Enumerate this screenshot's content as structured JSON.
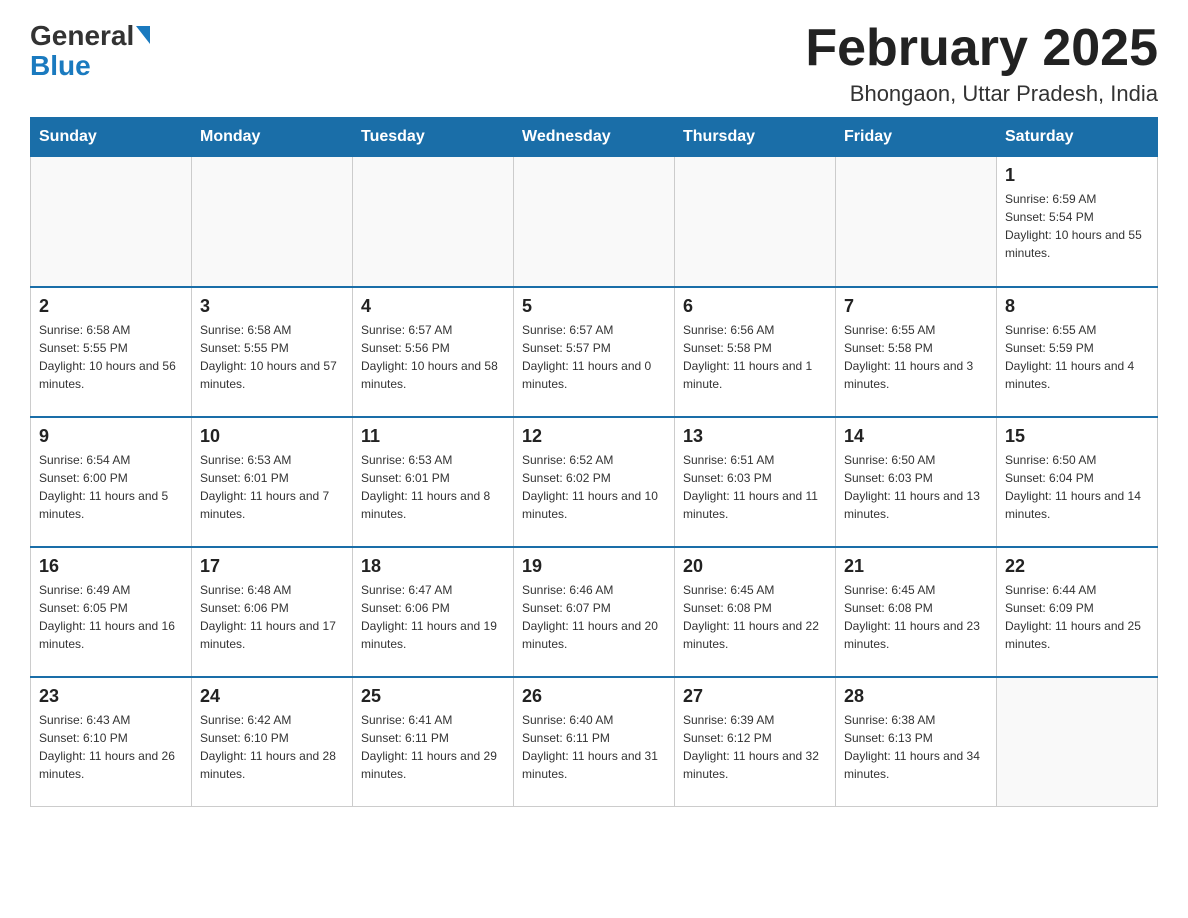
{
  "header": {
    "logo_general": "General",
    "logo_blue": "Blue",
    "month_title": "February 2025",
    "location": "Bhongaon, Uttar Pradesh, India"
  },
  "weekdays": [
    "Sunday",
    "Monday",
    "Tuesday",
    "Wednesday",
    "Thursday",
    "Friday",
    "Saturday"
  ],
  "weeks": [
    [
      {
        "day": "",
        "sunrise": "",
        "sunset": "",
        "daylight": ""
      },
      {
        "day": "",
        "sunrise": "",
        "sunset": "",
        "daylight": ""
      },
      {
        "day": "",
        "sunrise": "",
        "sunset": "",
        "daylight": ""
      },
      {
        "day": "",
        "sunrise": "",
        "sunset": "",
        "daylight": ""
      },
      {
        "day": "",
        "sunrise": "",
        "sunset": "",
        "daylight": ""
      },
      {
        "day": "",
        "sunrise": "",
        "sunset": "",
        "daylight": ""
      },
      {
        "day": "1",
        "sunrise": "Sunrise: 6:59 AM",
        "sunset": "Sunset: 5:54 PM",
        "daylight": "Daylight: 10 hours and 55 minutes."
      }
    ],
    [
      {
        "day": "2",
        "sunrise": "Sunrise: 6:58 AM",
        "sunset": "Sunset: 5:55 PM",
        "daylight": "Daylight: 10 hours and 56 minutes."
      },
      {
        "day": "3",
        "sunrise": "Sunrise: 6:58 AM",
        "sunset": "Sunset: 5:55 PM",
        "daylight": "Daylight: 10 hours and 57 minutes."
      },
      {
        "day": "4",
        "sunrise": "Sunrise: 6:57 AM",
        "sunset": "Sunset: 5:56 PM",
        "daylight": "Daylight: 10 hours and 58 minutes."
      },
      {
        "day": "5",
        "sunrise": "Sunrise: 6:57 AM",
        "sunset": "Sunset: 5:57 PM",
        "daylight": "Daylight: 11 hours and 0 minutes."
      },
      {
        "day": "6",
        "sunrise": "Sunrise: 6:56 AM",
        "sunset": "Sunset: 5:58 PM",
        "daylight": "Daylight: 11 hours and 1 minute."
      },
      {
        "day": "7",
        "sunrise": "Sunrise: 6:55 AM",
        "sunset": "Sunset: 5:58 PM",
        "daylight": "Daylight: 11 hours and 3 minutes."
      },
      {
        "day": "8",
        "sunrise": "Sunrise: 6:55 AM",
        "sunset": "Sunset: 5:59 PM",
        "daylight": "Daylight: 11 hours and 4 minutes."
      }
    ],
    [
      {
        "day": "9",
        "sunrise": "Sunrise: 6:54 AM",
        "sunset": "Sunset: 6:00 PM",
        "daylight": "Daylight: 11 hours and 5 minutes."
      },
      {
        "day": "10",
        "sunrise": "Sunrise: 6:53 AM",
        "sunset": "Sunset: 6:01 PM",
        "daylight": "Daylight: 11 hours and 7 minutes."
      },
      {
        "day": "11",
        "sunrise": "Sunrise: 6:53 AM",
        "sunset": "Sunset: 6:01 PM",
        "daylight": "Daylight: 11 hours and 8 minutes."
      },
      {
        "day": "12",
        "sunrise": "Sunrise: 6:52 AM",
        "sunset": "Sunset: 6:02 PM",
        "daylight": "Daylight: 11 hours and 10 minutes."
      },
      {
        "day": "13",
        "sunrise": "Sunrise: 6:51 AM",
        "sunset": "Sunset: 6:03 PM",
        "daylight": "Daylight: 11 hours and 11 minutes."
      },
      {
        "day": "14",
        "sunrise": "Sunrise: 6:50 AM",
        "sunset": "Sunset: 6:03 PM",
        "daylight": "Daylight: 11 hours and 13 minutes."
      },
      {
        "day": "15",
        "sunrise": "Sunrise: 6:50 AM",
        "sunset": "Sunset: 6:04 PM",
        "daylight": "Daylight: 11 hours and 14 minutes."
      }
    ],
    [
      {
        "day": "16",
        "sunrise": "Sunrise: 6:49 AM",
        "sunset": "Sunset: 6:05 PM",
        "daylight": "Daylight: 11 hours and 16 minutes."
      },
      {
        "day": "17",
        "sunrise": "Sunrise: 6:48 AM",
        "sunset": "Sunset: 6:06 PM",
        "daylight": "Daylight: 11 hours and 17 minutes."
      },
      {
        "day": "18",
        "sunrise": "Sunrise: 6:47 AM",
        "sunset": "Sunset: 6:06 PM",
        "daylight": "Daylight: 11 hours and 19 minutes."
      },
      {
        "day": "19",
        "sunrise": "Sunrise: 6:46 AM",
        "sunset": "Sunset: 6:07 PM",
        "daylight": "Daylight: 11 hours and 20 minutes."
      },
      {
        "day": "20",
        "sunrise": "Sunrise: 6:45 AM",
        "sunset": "Sunset: 6:08 PM",
        "daylight": "Daylight: 11 hours and 22 minutes."
      },
      {
        "day": "21",
        "sunrise": "Sunrise: 6:45 AM",
        "sunset": "Sunset: 6:08 PM",
        "daylight": "Daylight: 11 hours and 23 minutes."
      },
      {
        "day": "22",
        "sunrise": "Sunrise: 6:44 AM",
        "sunset": "Sunset: 6:09 PM",
        "daylight": "Daylight: 11 hours and 25 minutes."
      }
    ],
    [
      {
        "day": "23",
        "sunrise": "Sunrise: 6:43 AM",
        "sunset": "Sunset: 6:10 PM",
        "daylight": "Daylight: 11 hours and 26 minutes."
      },
      {
        "day": "24",
        "sunrise": "Sunrise: 6:42 AM",
        "sunset": "Sunset: 6:10 PM",
        "daylight": "Daylight: 11 hours and 28 minutes."
      },
      {
        "day": "25",
        "sunrise": "Sunrise: 6:41 AM",
        "sunset": "Sunset: 6:11 PM",
        "daylight": "Daylight: 11 hours and 29 minutes."
      },
      {
        "day": "26",
        "sunrise": "Sunrise: 6:40 AM",
        "sunset": "Sunset: 6:11 PM",
        "daylight": "Daylight: 11 hours and 31 minutes."
      },
      {
        "day": "27",
        "sunrise": "Sunrise: 6:39 AM",
        "sunset": "Sunset: 6:12 PM",
        "daylight": "Daylight: 11 hours and 32 minutes."
      },
      {
        "day": "28",
        "sunrise": "Sunrise: 6:38 AM",
        "sunset": "Sunset: 6:13 PM",
        "daylight": "Daylight: 11 hours and 34 minutes."
      },
      {
        "day": "",
        "sunrise": "",
        "sunset": "",
        "daylight": ""
      }
    ]
  ]
}
